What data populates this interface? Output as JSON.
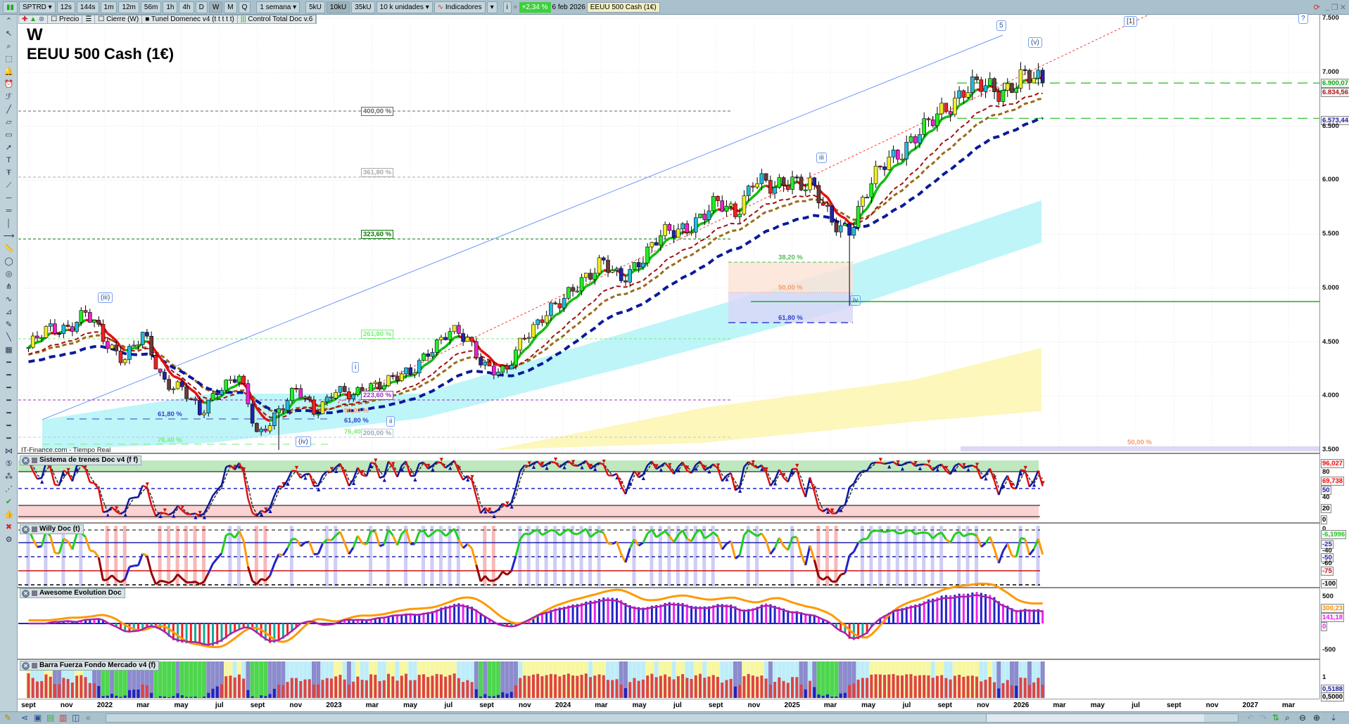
{
  "toolbar": {
    "symbol": "SPTRD ▾",
    "periods": [
      "12s",
      "144s",
      "1m",
      "12m",
      "56m",
      "1h",
      "4h",
      "D",
      "W",
      "M",
      "Q"
    ],
    "selected_period": "W",
    "range": "1 semana ▾",
    "units": [
      "5kU",
      "10kU",
      "35kU"
    ],
    "selected_unit": "10kU",
    "units_select": "10 k unidades ▾",
    "indicators": "Indicadores",
    "change": "+2,34 %",
    "date": "6 feb 2026",
    "instrument": "EEUU 500 Cash (1€)"
  },
  "legend": [
    "Precio",
    "Cierre (W)",
    "Tunel Domenec v4 (t t t t t)",
    "Control Total Doc v.6"
  ],
  "chart": {
    "timeframe": "W",
    "title": "EEUU 500 Cash (1€)",
    "source": "IT-Finance.com - Tiempo Real",
    "price_axis": [
      "7.500",
      "7.000",
      "6.500",
      "6.000",
      "5.500",
      "5.000",
      "4.500",
      "4.000",
      "3.500"
    ],
    "price_markers": {
      "green": "6.900,07",
      "red": "6.834,56",
      "blue": "6.573,44"
    },
    "fib_labels": {
      "f400": "400,00 %",
      "f3618": "361,80 %",
      "f3236": "323,60 %",
      "f2618": "261,80 %",
      "f2236": "223,60 %",
      "f200": "200,00 %",
      "f50a": "50,00 %",
      "f618a": "61,80 %",
      "f764a": "76,40",
      "f618l": "61,80 %",
      "f764l": "76,40 %",
      "f382r": "38,20 %",
      "f50r": "50,00 %",
      "f618r": "61,80 %",
      "f50b": "50,00 %"
    },
    "waves": {
      "w3p": "(iii)",
      "wi": "i",
      "wii": "ii",
      "w4p": "(iv)",
      "wiii": "iii",
      "wiv": "iv",
      "w5": "5",
      "w5p": "(v)",
      "w1b": "[1]",
      "wq": "?"
    }
  },
  "panels": {
    "sistema": {
      "title": "Sistema de trenes Doc v4 (f f)",
      "axis": [
        "80",
        "40",
        "20",
        "0"
      ],
      "markers": {
        "a": "96,027",
        "b": "69,738",
        "c": "50"
      }
    },
    "willy": {
      "title": "Willy Doc (t)",
      "axis": [
        "0",
        "-40",
        "-60"
      ],
      "markers": {
        "a": "-6,1996",
        "b": "-25",
        "c": "-50",
        "d": "-75",
        "e": "-100"
      }
    },
    "awesome": {
      "title": "Awesome Evolution Doc",
      "axis": [
        "500",
        "-500"
      ],
      "markers": {
        "a": "300,23",
        "b": "141,18",
        "c": "0"
      }
    },
    "barra": {
      "title": "Barra Fuerza Fondo Mercado v4 (f)",
      "axis": [
        "1"
      ],
      "markers": {
        "a": "0,5188",
        "b": "0,5000"
      }
    }
  },
  "time_axis": [
    "sept",
    "nov",
    "2022",
    "mar",
    "may",
    "jul",
    "sept",
    "nov",
    "2023",
    "mar",
    "may",
    "jul",
    "sept",
    "nov",
    "2024",
    "mar",
    "may",
    "jul",
    "sept",
    "nov",
    "2025",
    "mar",
    "may",
    "jul",
    "sept",
    "nov",
    "2026",
    "mar",
    "may",
    "jul",
    "sept",
    "nov",
    "2027",
    "mar"
  ],
  "colors": {
    "up": "#22cc22",
    "down": "#cc2222",
    "ma_fast": "#11aa11",
    "ma_slow": "#0a1a99",
    "accent": "#3cd13c"
  },
  "chart_data": {
    "type": "candlestick",
    "title": "EEUU 500 Cash (1€) W",
    "start_month": "2021-09",
    "monthly_close": [
      4450,
      4600,
      4650,
      4760,
      4500,
      4370,
      4550,
      4150,
      4100,
      3800,
      4100,
      4200,
      3600,
      3870,
      4050,
      3840,
      4080,
      3970,
      4110,
      4170,
      4180,
      4450,
      4590,
      4510,
      4290,
      4190,
      4570,
      4770,
      4850,
      5100,
      5250,
      5040,
      5280,
      5460,
      5520,
      5650,
      5760,
      5700,
      6030,
      5880,
      6040,
      5950,
      5600,
      5570,
      5900,
      6200,
      6340,
      6460,
      6690,
      6840,
      6850,
      6850,
      6940,
      6900
    ],
    "extremes": [
      {
        "month_index": 13,
        "low": 3500
      },
      {
        "month_index": 43,
        "low": 4835
      }
    ],
    "ylim": [
      3500,
      7500
    ]
  }
}
